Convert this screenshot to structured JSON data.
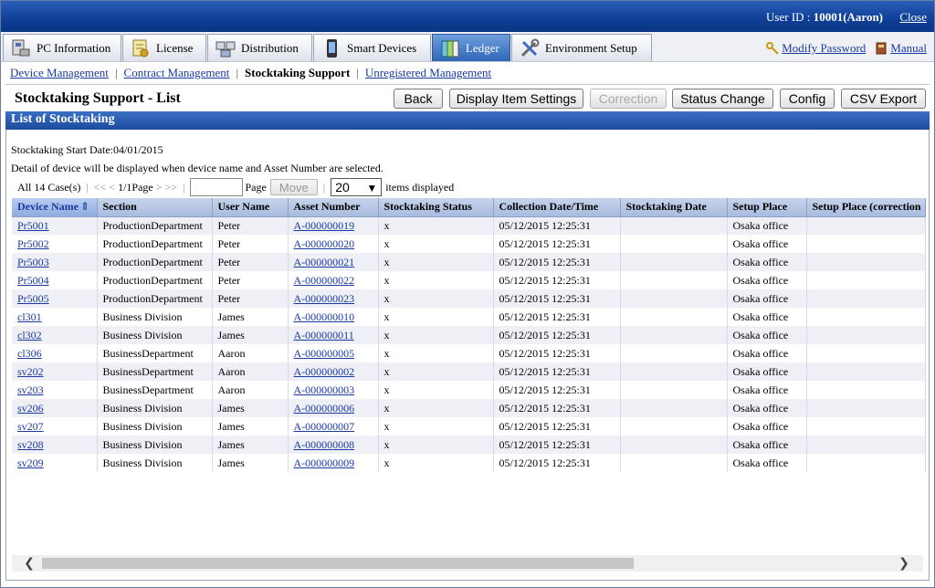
{
  "header": {
    "user_label": "User ID : ",
    "user_value": "10001(Aaron)",
    "close": "Close"
  },
  "tabs": [
    {
      "label": "PC Information",
      "icon": "pc-information-icon"
    },
    {
      "label": "License",
      "icon": "license-icon"
    },
    {
      "label": "Distribution",
      "icon": "distribution-icon"
    },
    {
      "label": "Smart Devices",
      "icon": "smart-devices-icon"
    },
    {
      "label": "Ledger",
      "icon": "ledger-icon"
    },
    {
      "label": "Environment Setup",
      "icon": "environment-setup-icon"
    }
  ],
  "right_links": {
    "modify_password": "Modify Password",
    "manual": "Manual"
  },
  "subnav": {
    "device_management": "Device Management",
    "contract_management": "Contract Management",
    "stocktaking_support": "Stocktaking Support",
    "unregistered_management": "Unregistered Management",
    "separator": "|"
  },
  "page": {
    "title": "Stocktaking Support - List"
  },
  "buttons": {
    "back": "Back",
    "display_item_settings": "Display Item Settings",
    "correction": "Correction",
    "status_change": "Status Change",
    "config": "Config",
    "csv_export": "CSV Export"
  },
  "section": {
    "title": "List of Stocktaking",
    "start_date": "Stocktaking Start Date:04/01/2015",
    "detail_note": "Detail of device will be displayed when device name and Asset Number are selected."
  },
  "pager": {
    "total": "All 14 Case(s)",
    "first": "<<",
    "prev": "<",
    "page_info": "1/1Page",
    "next": ">",
    "last": ">>",
    "page_label": "Page",
    "page_input": "",
    "move": "Move",
    "per_page": "20",
    "items_displayed": "items displayed"
  },
  "table": {
    "columns": [
      "Device Name",
      "Section",
      "User Name",
      "Asset Number",
      "Stocktaking Status",
      "Collection Date/Time",
      "Stocktaking Date",
      "Setup Place",
      "Setup Place (correction"
    ],
    "sort_indicator": "⇑",
    "rows": [
      [
        "Pr5001",
        "ProductionDepartment",
        "Peter",
        "A-000000019",
        "x",
        "05/12/2015 12:25:31",
        "",
        "Osaka office",
        ""
      ],
      [
        "Pr5002",
        "ProductionDepartment",
        "Peter",
        "A-000000020",
        "x",
        "05/12/2015 12:25:31",
        "",
        "Osaka office",
        ""
      ],
      [
        "Pr5003",
        "ProductionDepartment",
        "Peter",
        "A-000000021",
        "x",
        "05/12/2015 12:25:31",
        "",
        "Osaka office",
        ""
      ],
      [
        "Pr5004",
        "ProductionDepartment",
        "Peter",
        "A-000000022",
        "x",
        "05/12/2015 12:25:31",
        "",
        "Osaka office",
        ""
      ],
      [
        "Pr5005",
        "ProductionDepartment",
        "Peter",
        "A-000000023",
        "x",
        "05/12/2015 12:25:31",
        "",
        "Osaka office",
        ""
      ],
      [
        "cl301",
        "Business Division",
        "James",
        "A-000000010",
        "x",
        "05/12/2015 12:25:31",
        "",
        "Osaka office",
        ""
      ],
      [
        "cl302",
        "Business Division",
        "James",
        "A-000000011",
        "x",
        "05/12/2015 12:25:31",
        "",
        "Osaka office",
        ""
      ],
      [
        "cl306",
        "BusinessDepartment",
        "Aaron",
        "A-000000005",
        "x",
        "05/12/2015 12:25:31",
        "",
        "Osaka office",
        ""
      ],
      [
        "sv202",
        "BusinessDepartment",
        "Aaron",
        "A-000000002",
        "x",
        "05/12/2015 12:25:31",
        "",
        "Osaka office",
        ""
      ],
      [
        "sv203",
        "BusinessDepartment",
        "Aaron",
        "A-000000003",
        "x",
        "05/12/2015 12:25:31",
        "",
        "Osaka office",
        ""
      ],
      [
        "sv206",
        "Business Division",
        "James",
        "A-000000006",
        "x",
        "05/12/2015 12:25:31",
        "",
        "Osaka office",
        ""
      ],
      [
        "sv207",
        "Business Division",
        "James",
        "A-000000007",
        "x",
        "05/12/2015 12:25:31",
        "",
        "Osaka office",
        ""
      ],
      [
        "sv208",
        "Business Division",
        "James",
        "A-000000008",
        "x",
        "05/12/2015 12:25:31",
        "",
        "Osaka office",
        ""
      ],
      [
        "sv209",
        "Business Division",
        "James",
        "A-000000009",
        "x",
        "05/12/2015 12:25:31",
        "",
        "Osaka office",
        ""
      ]
    ]
  },
  "scrollbar": {
    "left_arrow": "❮",
    "right_arrow": "❯"
  },
  "colors": {
    "banner": "#0f3f96",
    "active_tab": "#2f66b8",
    "section_header": "#1c4b9c",
    "link": "#1a3aa0"
  }
}
